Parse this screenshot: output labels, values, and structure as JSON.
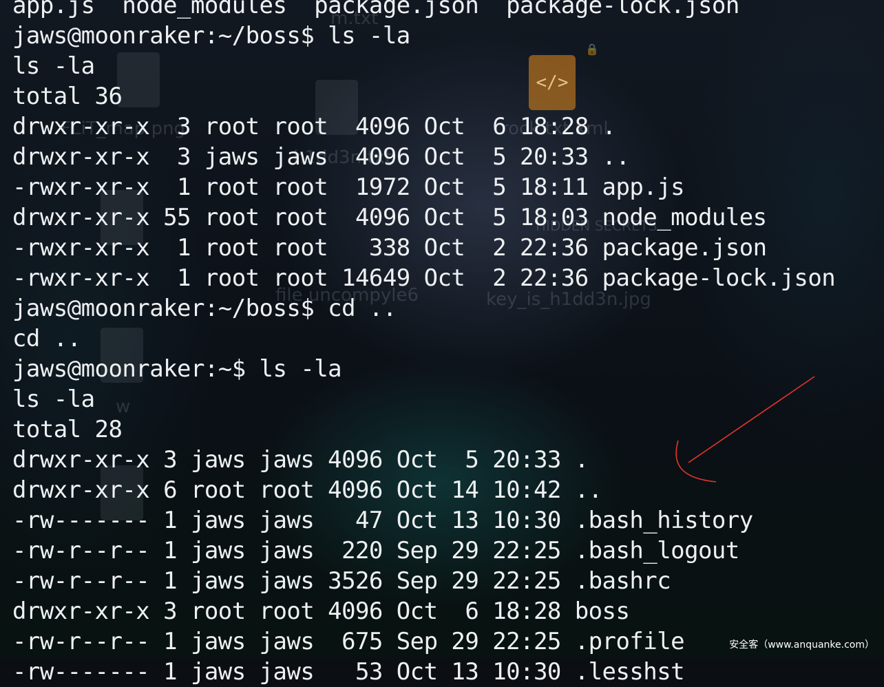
{
  "terminal": {
    "lines": [
      "app.js  node_modules  package.json  package-lock.json",
      "jaws@moonraker:~/boss$ ls -la",
      "ls -la",
      "total 36",
      "drwxr-xr-x  3 root root  4096 Oct  6 18:28 .",
      "drwxr-xr-x  3 jaws jaws  4096 Oct  5 20:33 ..",
      "-rwxr-xr-x  1 root root  1972 Oct  5 18:11 app.js",
      "drwxr-xr-x 55 root root  4096 Oct  5 18:03 node_modules",
      "-rwxr-xr-x  1 root root   338 Oct  2 22:36 package.json",
      "-rwxr-xr-x  1 root root 14649 Oct  2 22:36 package-lock.json",
      "jaws@moonraker:~/boss$ cd ..",
      "cd ..",
      "jaws@moonraker:~$ ls -la",
      "ls -la",
      "total 28",
      "drwxr-xr-x 3 jaws jaws 4096 Oct  5 20:33 .",
      "drwxr-xr-x 6 root root 4096 Oct 14 10:42 ..",
      "-rw------- 1 jaws jaws   47 Oct 13 10:30 .bash_history",
      "-rw-r--r-- 1 jaws jaws  220 Sep 29 22:25 .bash_logout",
      "-rw-r--r-- 1 jaws jaws 3526 Sep 29 22:25 .bashrc",
      "drwxr-xr-x 3 root root 4096 Oct  6 18:28 boss",
      "-rw-r--r-- 1 jaws jaws  675 Sep 29 22:25 .profile",
      "-rw------- 1 jaws jaws   53 Oct 13 10:30 .lesshst"
    ],
    "text_color": "#eef0f2"
  },
  "desktop": {
    "labels": {
      "txt": "m.txt",
      "map": "FLiT_map.png",
      "xml": "rock.txt.xml",
      "hidden1": "h1dd3n.txt",
      "hidden2": "HIDDEN SECRETS",
      "key": "key_is_h1dd3n.jpg",
      "uncompyle": "file uncompyle6",
      "w": "w"
    },
    "folder_icon": "</>"
  },
  "annotation": {
    "color": "#e8342c"
  },
  "watermark": "安全客（www.anquanke.com）"
}
